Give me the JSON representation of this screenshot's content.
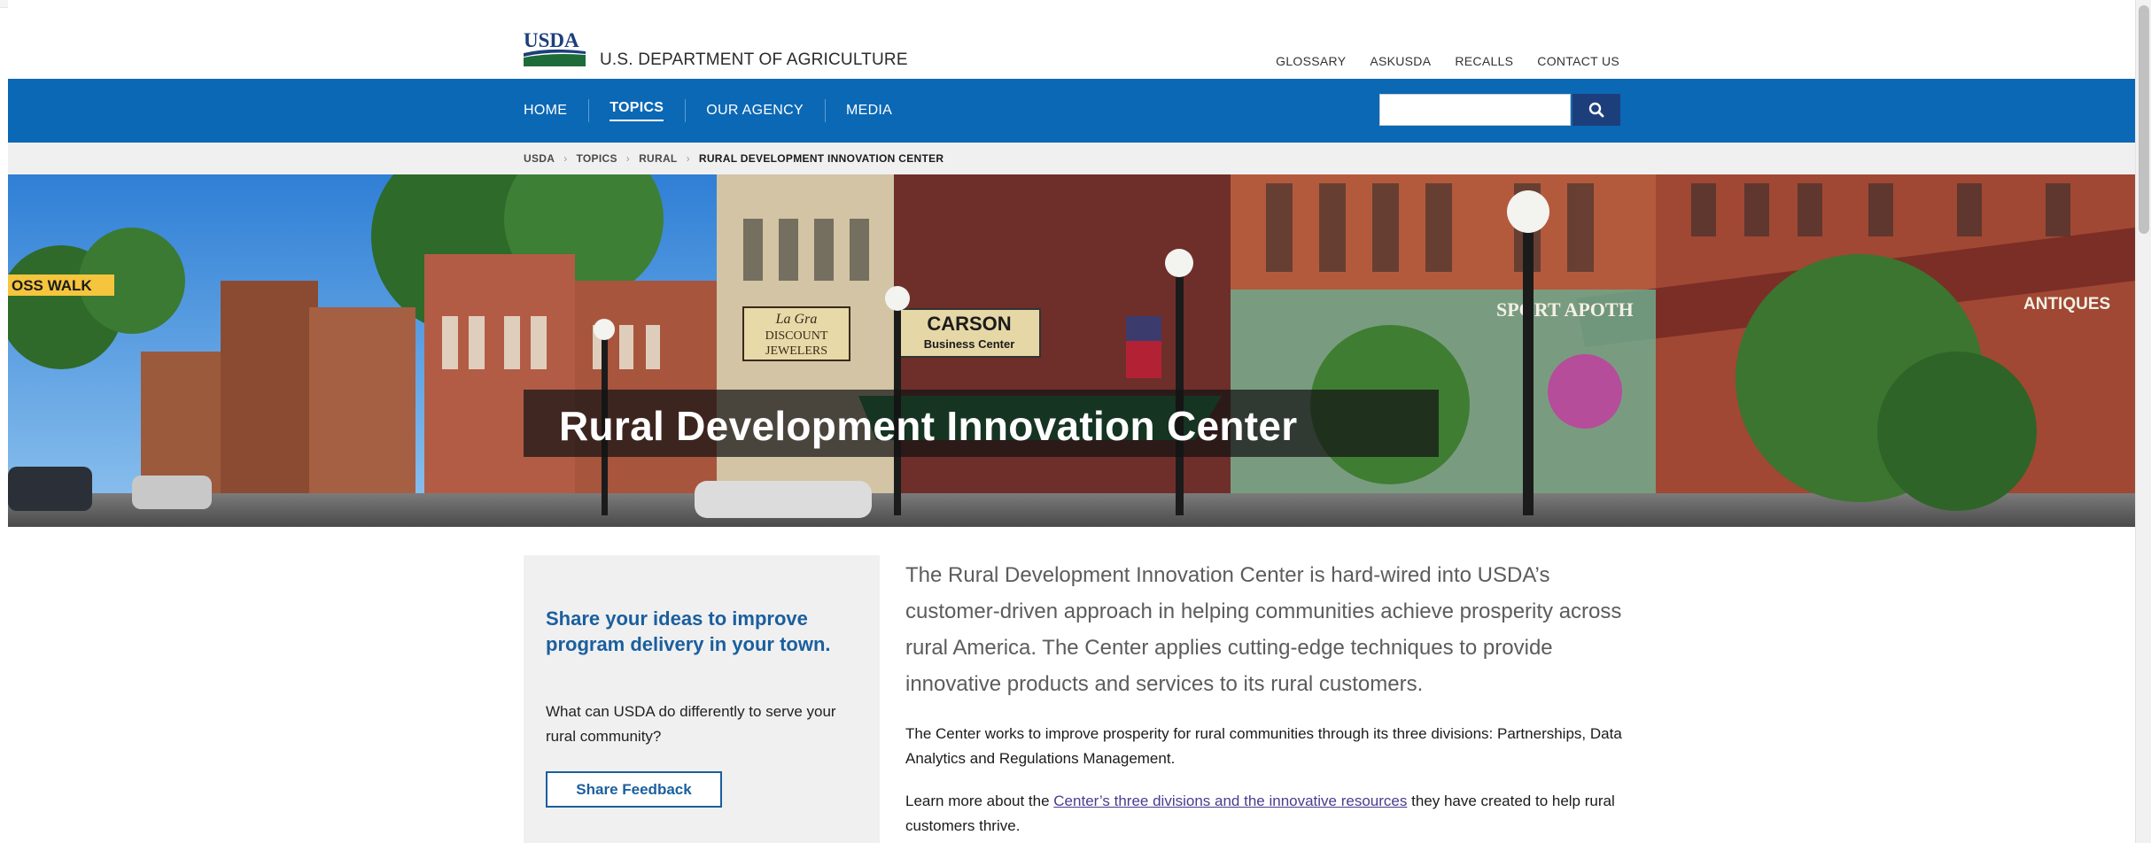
{
  "header": {
    "department": "U.S. DEPARTMENT OF AGRICULTURE",
    "logo_text": "USDA",
    "utility_nav": [
      "GLOSSARY",
      "ASKUSDA",
      "RECALLS",
      "CONTACT US"
    ]
  },
  "nav": {
    "items": [
      {
        "label": "HOME",
        "active": false
      },
      {
        "label": "TOPICS",
        "active": true
      },
      {
        "label": "OUR AGENCY",
        "active": false
      },
      {
        "label": "MEDIA",
        "active": false
      }
    ],
    "search": {
      "placeholder": "",
      "value": "",
      "icon": "search-icon"
    }
  },
  "breadcrumb": [
    "USDA",
    "TOPICS",
    "RURAL",
    "RURAL DEVELOPMENT INNOVATION CENTER"
  ],
  "hero": {
    "title": "Rural Development Innovation Center",
    "signs": {
      "crossing": "OSS WALK",
      "jewelers": [
        "La Gra",
        "DISCOUNT",
        "JEWELERS"
      ],
      "carson": [
        "CARSON",
        "Business Center"
      ],
      "antiques": "ANTIQUES",
      "apothecary": "SPORT APOTH"
    }
  },
  "sidebar": {
    "heading": "Share your ideas to improve program delivery in your town.",
    "text": "What can USDA do differently to serve your rural community?",
    "button": "Share Feedback"
  },
  "main": {
    "lead": "The Rural Development Innovation Center is hard-wired into USDA’s customer-driven approach in helping communities achieve prosperity across rural America. The Center applies cutting-edge techniques to provide innovative products and services to its rural customers.",
    "paragraph_1": "The Center works to improve prosperity for rural communities through its three divisions: Partnerships, Data Analytics and Regulations Management.",
    "paragraph_2_before": "Learn more about the ",
    "paragraph_2_link": "Center’s three divisions and the innovative resources",
    "paragraph_2_after": " they have created to help rural customers thrive."
  },
  "colors": {
    "nav_blue": "#0b68b5",
    "search_button": "#1c3f7c",
    "heading_blue": "#1a5f9e",
    "logo_green": "#1e6b3a",
    "logo_blue": "#1c3f7c"
  }
}
